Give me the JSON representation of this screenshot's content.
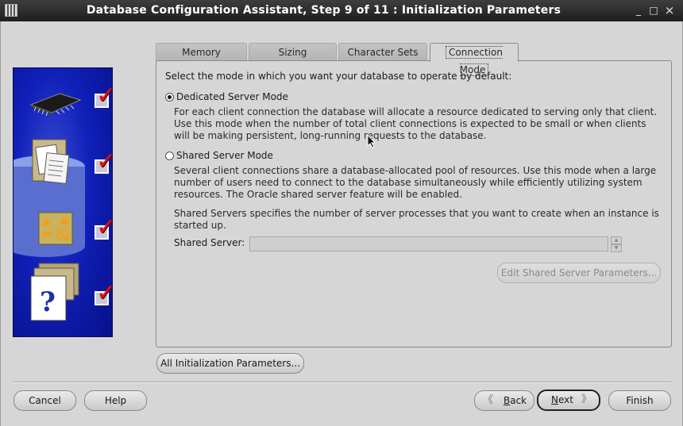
{
  "window": {
    "title": "Database Configuration Assistant, Step 9 of 11 : Initialization Parameters",
    "controls": {
      "minimize": "_",
      "maximize": "□",
      "close": "×"
    }
  },
  "tabs": [
    {
      "label": "Memory"
    },
    {
      "label": "Sizing"
    },
    {
      "label": "Character Sets"
    },
    {
      "label": "Connection Mode",
      "active": true
    }
  ],
  "panel": {
    "intro": "Select the mode in which you want your database to operate by default:",
    "dedicated": {
      "label": "Dedicated Server Mode",
      "selected": true,
      "description": "For each client connection the database will allocate a resource dedicated to serving only that client.  Use this mode when the number of total client connections is expected to be small or when clients will be making persistent, long-running requests to the database."
    },
    "shared": {
      "label": "Shared Server Mode",
      "selected": false,
      "description": "Several client connections share a database-allocated pool of resources.  Use this mode when a large number of users need to connect to the database simultaneously while efficiently utilizing system resources.  The Oracle shared server feature will be enabled."
    },
    "shared_servers_note": "Shared Servers specifies the number of server processes that you want to create when an instance is started up.",
    "shared_server_label": "Shared Server:",
    "shared_server_value": "",
    "edit_params_button": "Edit Shared Server Parameters..."
  },
  "all_params_button": "All Initialization Parameters...",
  "footer": {
    "cancel": "Cancel",
    "help": "Help",
    "back": "Back",
    "next": "Next",
    "finish": "Finish"
  },
  "side_icons": [
    "chip-icon",
    "folder-documents-icon",
    "shapes-folder-icon",
    "help-document-icon"
  ],
  "colors": {
    "side_panel": "#1020b8",
    "titlebar": "#2a2a2a",
    "checkmark": "#e01010"
  }
}
